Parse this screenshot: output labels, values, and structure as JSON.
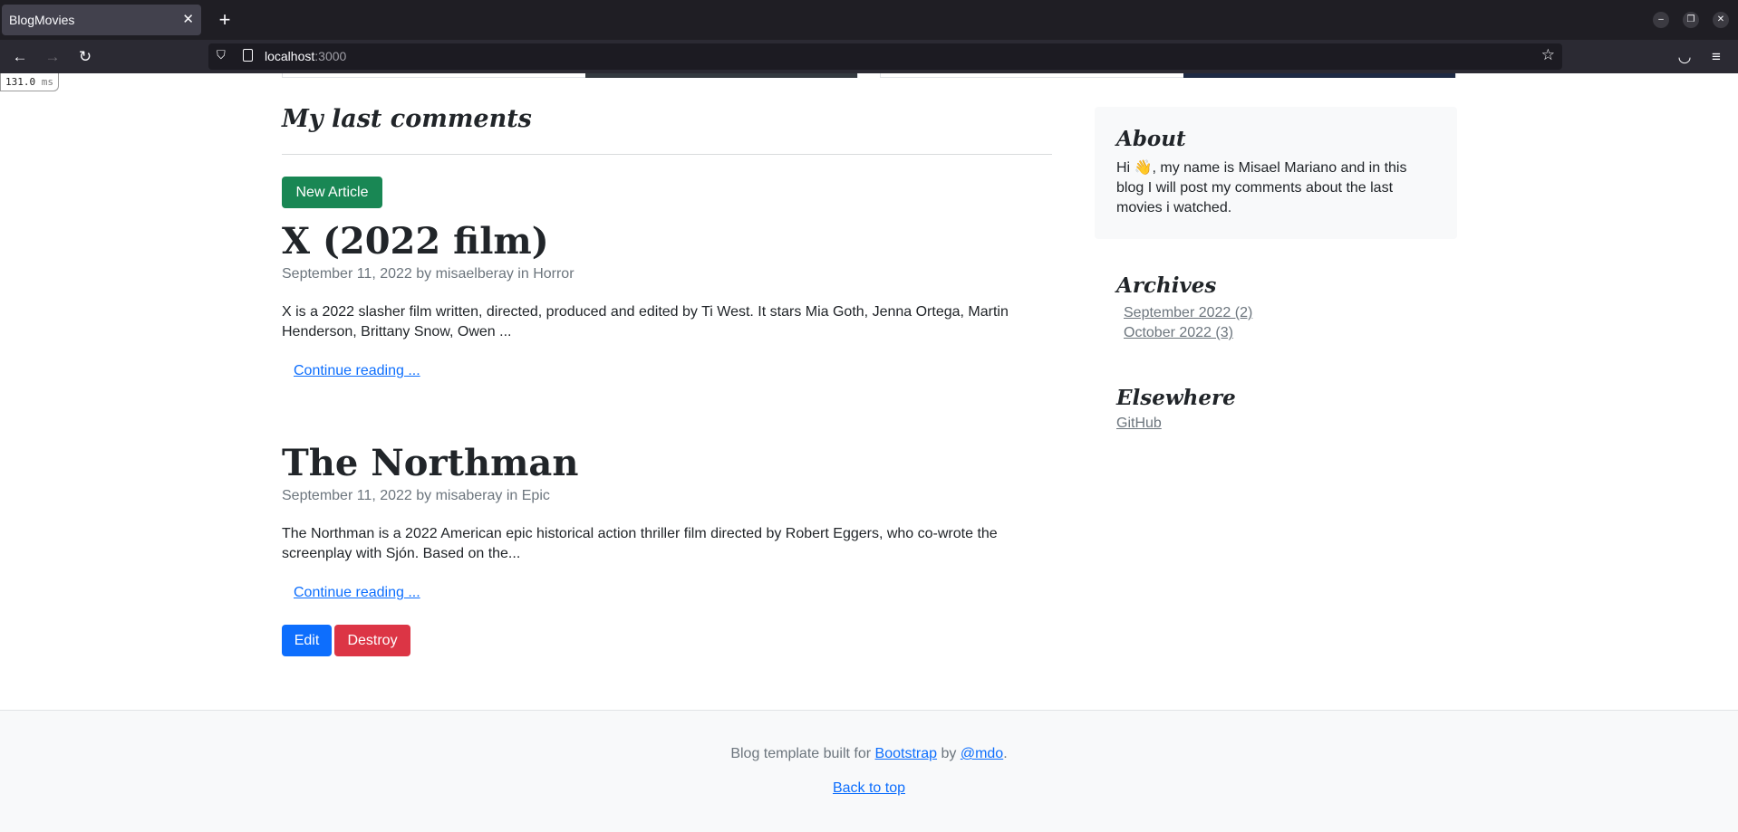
{
  "browser": {
    "tab_title": "BlogMovies",
    "tab_close": "✕",
    "new_tab": "+",
    "url_host": "localhost",
    "url_port": ":3000",
    "timing_value": "131.0",
    "timing_unit": "ms"
  },
  "main": {
    "section_title": "My last comments",
    "new_article_label": "New Article",
    "posts": [
      {
        "title": "X (2022 film)",
        "meta": "September 11, 2022 by misaelberay in Horror",
        "excerpt": "X is a 2022 slasher film written, directed, produced and edited by Ti West. It stars Mia Goth, Jenna Ortega, Martin Henderson, Brittany Snow, Owen ...",
        "continue_label": "Continue reading ..."
      },
      {
        "title": "The Northman",
        "meta": "September 11, 2022 by misaberay in Epic",
        "excerpt": "The Northman is a 2022 American epic historical action thriller film directed by Robert Eggers, who co-wrote the screenplay with Sjón. Based on the...",
        "continue_label": "Continue reading ..."
      }
    ],
    "edit_label": "Edit",
    "destroy_label": "Destroy"
  },
  "sidebar": {
    "about_title": "About",
    "about_text": "Hi 👋, my name is Misael Mariano and in this blog I will post my comments about the last movies i watched.",
    "archives_title": "Archives",
    "archives": [
      {
        "label": "September 2022 (2)"
      },
      {
        "label": "October 2022 (3)"
      }
    ],
    "elsewhere_title": "Elsewhere",
    "elsewhere_links": [
      {
        "label": "GitHub"
      }
    ]
  },
  "footer": {
    "text_prefix": "Blog template built for",
    "bootstrap_label": "Bootstrap",
    "text_by": "by",
    "mdo_label": "@mdo",
    "text_period": ".",
    "back_to_top_label": "Back to top"
  }
}
